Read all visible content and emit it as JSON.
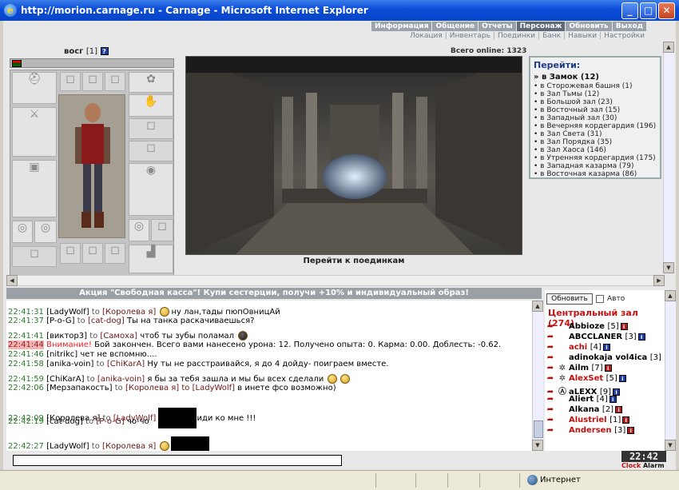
{
  "window": {
    "title": "http://morion.carnage.ru - Carnage - Microsoft Internet Explorer",
    "minimize": "_",
    "maximize": "□",
    "close": "✕"
  },
  "top_menu": [
    "Информация",
    "Общение",
    "Отчеты",
    "Персонаж",
    "Обновить",
    "Выход"
  ],
  "top_menu_active": "Персонаж",
  "sub_menu": [
    "Локация",
    "Инвентарь",
    "Поединки",
    "Банк",
    "Навыки",
    "Настройки"
  ],
  "character": {
    "name": "восг",
    "level": "[1]",
    "help": "?"
  },
  "online_total": "Всего online: 1323",
  "scene_caption": "Перейти к поединкам",
  "goto": {
    "title": "Перейти:",
    "current": "» в Замок (12)",
    "locations": [
      "• в Сторожевая башня (1)",
      "• в Зал Тьмы (12)",
      "• в Большой зал (23)",
      "• в Восточный зал (15)",
      "• в Западный зал (30)",
      "• в Вечерняя кордегардия (196)",
      "• в Зал Света (31)",
      "• в Зал Порядка (35)",
      "• в Зал Хаоса (146)",
      "• в Утренняя кордегардия (175)",
      "• в Западная казарма (79)",
      "• в Восточная казарма (86)"
    ]
  },
  "promo": "Акция \"Свободная касса\"! Купи сестерции, получи +10% и индивидуальный образ!",
  "chat": {
    "messages": [
      {
        "time": "22:41:31",
        "nick": "[LadyWolf]",
        "to": "to",
        "target": "[Королева я]",
        "text": "ну лан,тады пюпОвницАй"
      },
      {
        "time": "22:41:37",
        "nick": "[P-o-G]",
        "to": "to",
        "target": "[cat-dog]",
        "text": "Ты на танка раскачиваешься?"
      },
      {
        "time": "22:41:41",
        "nick": "[виктор3]",
        "to": "to",
        "target": "[Самоха]",
        "text": "чтоб ты зубы поламал"
      },
      {
        "time": "22:41:44",
        "nick": "Внимание!",
        "to": "",
        "target": "",
        "text": "Бой закончен. Всего вами нанесено урона: 12. Получено опыта: 0. Карма: 0.00. Доблесть: -0.62."
      },
      {
        "time": "22:41:46",
        "nick": "[nitrikc]",
        "to": "",
        "target": "",
        "text": "чет не вспомню...."
      },
      {
        "time": "22:41:58",
        "nick": "[anika-voin]",
        "to": "to",
        "target": "[ChiKarA]",
        "text": "Ну ты не расстраивайся, я до 4 дойду- поиграем вместе."
      },
      {
        "time": "22:41:59",
        "nick": "[ChiKarA]",
        "to": "to",
        "target": "[anika-voin]",
        "text": "я бы за тебя зашла и мы бы всех сделали"
      },
      {
        "time": "22:42:06",
        "nick": "[Мерзапакость]",
        "to": "to",
        "target": "[Королева я] to [LadyWolf]",
        "text": "в инете фсо возможно)"
      },
      {
        "time": "22:42:09",
        "nick": "[Королева я]",
        "to": "to",
        "target": "[LadyWolf]",
        "text": "иди ко мне !!!"
      },
      {
        "time": "22:42:19",
        "nick": "[cat-dog]",
        "to": "to",
        "target": "[P-o-G]",
        "text": "чо-чо"
      },
      {
        "time": "22:42:27",
        "nick": "[LadyWolf]",
        "to": "to",
        "target": "[Королева я]",
        "text": ""
      }
    ]
  },
  "online_panel": {
    "refresh_label": "Обновить",
    "auto_label": "Авто",
    "room_title": "Центральный зал (274)",
    "users": [
      {
        "name": "Abbioze",
        "level": "[5]",
        "color": "#000000",
        "icon": "",
        "info": "red"
      },
      {
        "name": "ABCCLANER",
        "level": "[3]",
        "color": "#000000",
        "icon": "",
        "info": "blue"
      },
      {
        "name": "achi",
        "level": "[4]",
        "color": "#c01010",
        "icon": "",
        "info": "blue"
      },
      {
        "name": "adinokaja vol4ica",
        "level": "[3]",
        "color": "#000000",
        "icon": "",
        "info": ""
      },
      {
        "name": "Ailm",
        "level": "[7]",
        "color": "#000000",
        "icon": "✲",
        "info": "red"
      },
      {
        "name": "AlexSet",
        "level": "[5]",
        "color": "#c01010",
        "icon": "✲",
        "info": "blue"
      },
      {
        "name": "aLEXX",
        "level": "[9]",
        "color": "#000000",
        "icon": "Ⓐ",
        "info": "blue"
      },
      {
        "name": "Aliert",
        "level": "[4]",
        "color": "#000000",
        "icon": "",
        "info": "blue"
      },
      {
        "name": "Alkana",
        "level": "[2]",
        "color": "#000000",
        "icon": "",
        "info": "red"
      },
      {
        "name": "Alustriel",
        "level": "[1]",
        "color": "#c01010",
        "icon": "",
        "info": "red"
      },
      {
        "name": "Andersen",
        "level": "[3]",
        "color": "#c01010",
        "icon": "",
        "info": "red"
      }
    ]
  },
  "clock": {
    "time": "22:42",
    "label_clock": "Clock",
    "label_alarm": "Alarm"
  },
  "statusbar": {
    "zone": "Интернет"
  },
  "colors": {
    "titlebar": "#0a4bd8",
    "promo_bg": "#9aa0a6",
    "alert_text": "#ee2222",
    "room_title": "#c81010"
  }
}
